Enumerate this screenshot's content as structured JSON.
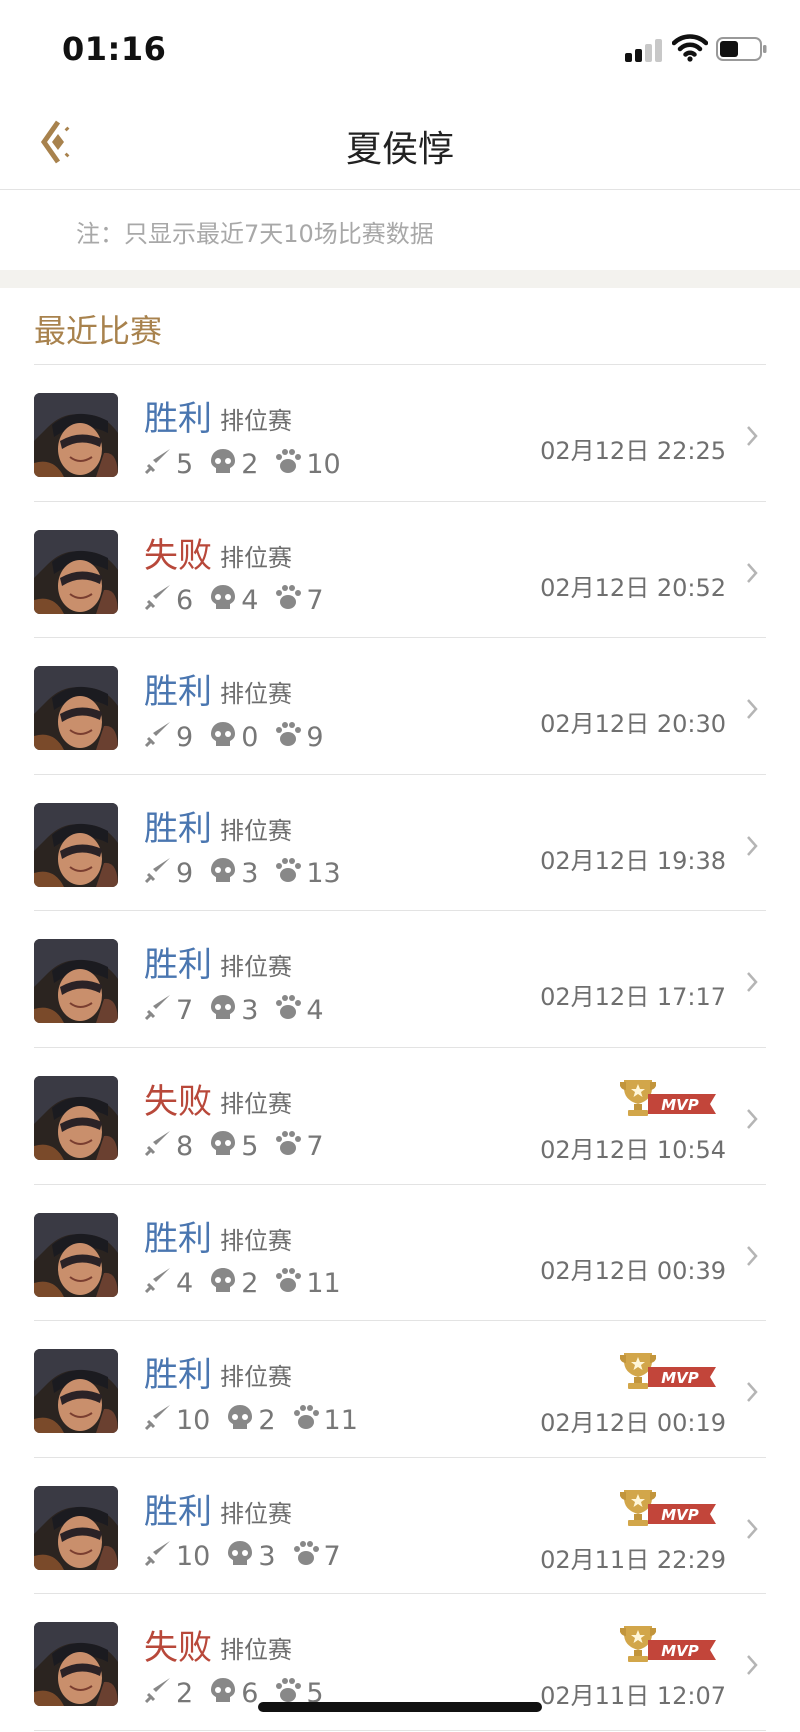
{
  "status_bar": {
    "time": "01:16"
  },
  "nav": {
    "title": "夏侯惇"
  },
  "note": {
    "text": "注：只显示最近7天10场比赛数据"
  },
  "section": {
    "title": "最近比赛"
  },
  "colors": {
    "win": "#4a76b0",
    "lose": "#b8483a",
    "accent": "#a8824d",
    "mvp": "#c2453a"
  },
  "icons": {
    "kill": "sword-icon",
    "death": "skull-icon",
    "assist": "paw-icon",
    "mvp": "mvp-trophy-icon",
    "more": "chevron-right-icon"
  },
  "matches": [
    {
      "result": "胜利",
      "outcome": "win",
      "mode": "排位赛",
      "kills": "5",
      "deaths": "2",
      "assists": "10",
      "time": "02月12日 22:25",
      "mvp": false
    },
    {
      "result": "失败",
      "outcome": "lose",
      "mode": "排位赛",
      "kills": "6",
      "deaths": "4",
      "assists": "7",
      "time": "02月12日 20:52",
      "mvp": false
    },
    {
      "result": "胜利",
      "outcome": "win",
      "mode": "排位赛",
      "kills": "9",
      "deaths": "0",
      "assists": "9",
      "time": "02月12日 20:30",
      "mvp": false
    },
    {
      "result": "胜利",
      "outcome": "win",
      "mode": "排位赛",
      "kills": "9",
      "deaths": "3",
      "assists": "13",
      "time": "02月12日 19:38",
      "mvp": false
    },
    {
      "result": "胜利",
      "outcome": "win",
      "mode": "排位赛",
      "kills": "7",
      "deaths": "3",
      "assists": "4",
      "time": "02月12日 17:17",
      "mvp": false
    },
    {
      "result": "失败",
      "outcome": "lose",
      "mode": "排位赛",
      "kills": "8",
      "deaths": "5",
      "assists": "7",
      "time": "02月12日 10:54",
      "mvp": true,
      "mvp_label": "MVP"
    },
    {
      "result": "胜利",
      "outcome": "win",
      "mode": "排位赛",
      "kills": "4",
      "deaths": "2",
      "assists": "11",
      "time": "02月12日 00:39",
      "mvp": false
    },
    {
      "result": "胜利",
      "outcome": "win",
      "mode": "排位赛",
      "kills": "10",
      "deaths": "2",
      "assists": "11",
      "time": "02月12日 00:19",
      "mvp": true,
      "mvp_label": "MVP"
    },
    {
      "result": "胜利",
      "outcome": "win",
      "mode": "排位赛",
      "kills": "10",
      "deaths": "3",
      "assists": "7",
      "time": "02月11日 22:29",
      "mvp": true,
      "mvp_label": "MVP"
    },
    {
      "result": "失败",
      "outcome": "lose",
      "mode": "排位赛",
      "kills": "2",
      "deaths": "6",
      "assists": "5",
      "time": "02月11日 12:07",
      "mvp": true,
      "mvp_label": "MVP"
    }
  ]
}
